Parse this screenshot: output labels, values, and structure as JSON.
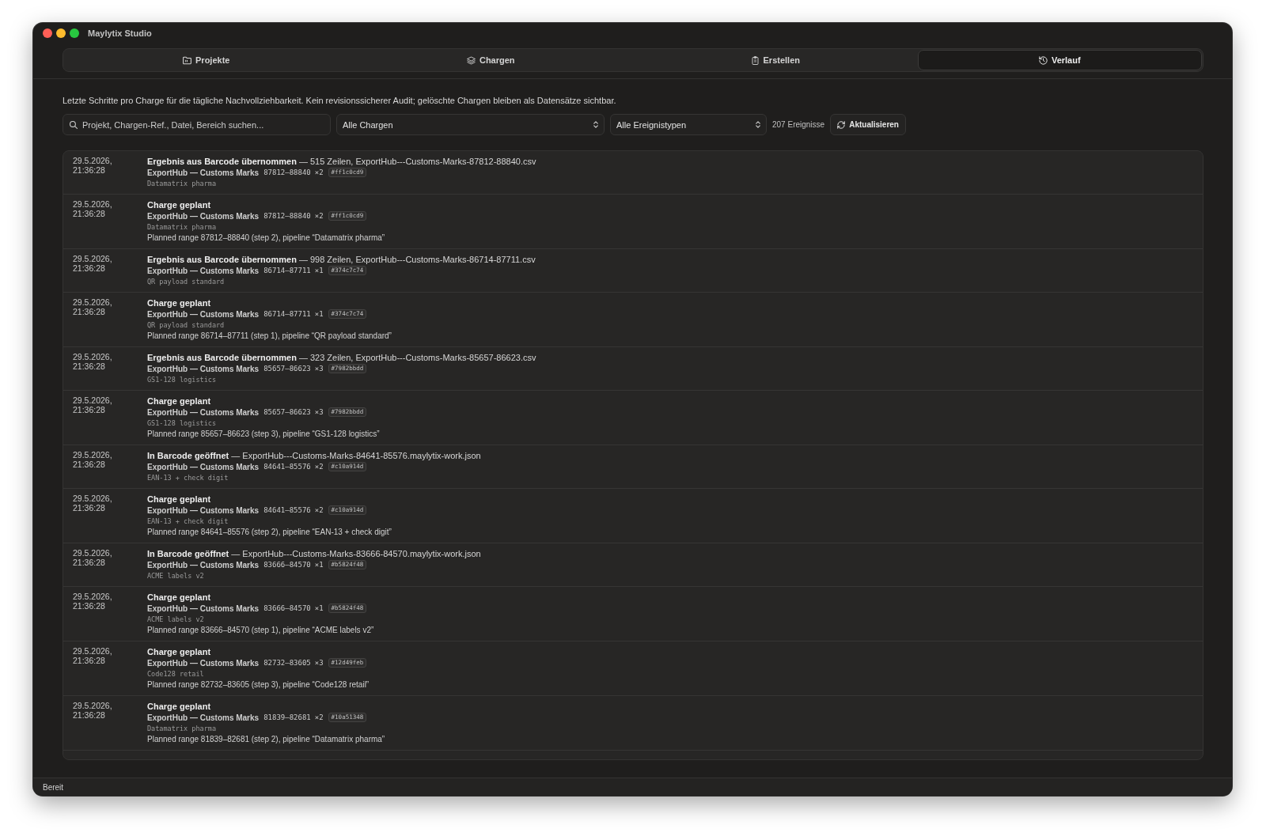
{
  "window": {
    "title": "Maylytix Studio"
  },
  "tabs": [
    {
      "label": "Projekte",
      "selected": false
    },
    {
      "label": "Chargen",
      "selected": false
    },
    {
      "label": "Erstellen",
      "selected": false
    },
    {
      "label": "Verlauf",
      "selected": true
    }
  ],
  "description": "Letzte Schritte pro Charge für die tägliche Nachvollziehbarkeit. Kein revisionssicherer Audit; gelöschte Chargen bleiben als Datensätze sichtbar.",
  "filters": {
    "search": {
      "placeholder": "Projekt, Chargen-Ref., Datei, Bereich suchen..."
    },
    "batch_select": {
      "value": "Alle Chargen"
    },
    "event_type_select": {
      "value": "Alle Ereignistypen"
    },
    "event_count": "207 Ereignisse",
    "refresh_button": "Aktualisieren"
  },
  "events": [
    {
      "timestamp": "29.5.2026, 21:36:28",
      "title": "Ergebnis aus Barcode übernommen",
      "detail": "— 515 Zeilen, ExportHub---Customs-Marks-87812-88840.csv",
      "project": "ExportHub — Customs Marks",
      "range": "87812–88840",
      "count": "×2",
      "hash": "#ff1c0cd9",
      "pipeline": "Datamatrix pharma"
    },
    {
      "timestamp": "29.5.2026, 21:36:28",
      "title": "Charge geplant",
      "project": "ExportHub — Customs Marks",
      "range": "87812–88840",
      "count": "×2",
      "hash": "#ff1c0cd9",
      "pipeline": "Datamatrix pharma",
      "note": "Planned range 87812–88840 (step 2), pipeline “Datamatrix pharma”"
    },
    {
      "timestamp": "29.5.2026, 21:36:28",
      "title": "Ergebnis aus Barcode übernommen",
      "detail": "— 998 Zeilen, ExportHub---Customs-Marks-86714-87711.csv",
      "project": "ExportHub — Customs Marks",
      "range": "86714–87711",
      "count": "×1",
      "hash": "#374c7c74",
      "pipeline": "QR payload standard"
    },
    {
      "timestamp": "29.5.2026, 21:36:28",
      "title": "Charge geplant",
      "project": "ExportHub — Customs Marks",
      "range": "86714–87711",
      "count": "×1",
      "hash": "#374c7c74",
      "pipeline": "QR payload standard",
      "note": "Planned range 86714–87711 (step 1), pipeline “QR payload standard”"
    },
    {
      "timestamp": "29.5.2026, 21:36:28",
      "title": "Ergebnis aus Barcode übernommen",
      "detail": "— 323 Zeilen, ExportHub---Customs-Marks-85657-86623.csv",
      "project": "ExportHub — Customs Marks",
      "range": "85657–86623",
      "count": "×3",
      "hash": "#7982bbdd",
      "pipeline": "GS1-128 logistics"
    },
    {
      "timestamp": "29.5.2026, 21:36:28",
      "title": "Charge geplant",
      "project": "ExportHub — Customs Marks",
      "range": "85657–86623",
      "count": "×3",
      "hash": "#7982bbdd",
      "pipeline": "GS1-128 logistics",
      "note": "Planned range 85657–86623 (step 3), pipeline “GS1-128 logistics”"
    },
    {
      "timestamp": "29.5.2026, 21:36:28",
      "title": "In Barcode geöffnet",
      "detail": "— ExportHub---Customs-Marks-84641-85576.maylytix-work.json",
      "project": "ExportHub — Customs Marks",
      "range": "84641–85576",
      "count": "×2",
      "hash": "#c10a914d",
      "pipeline": "EAN-13 + check digit"
    },
    {
      "timestamp": "29.5.2026, 21:36:28",
      "title": "Charge geplant",
      "project": "ExportHub — Customs Marks",
      "range": "84641–85576",
      "count": "×2",
      "hash": "#c10a914d",
      "pipeline": "EAN-13 + check digit",
      "note": "Planned range 84641–85576 (step 2), pipeline “EAN-13 + check digit”"
    },
    {
      "timestamp": "29.5.2026, 21:36:28",
      "title": "In Barcode geöffnet",
      "detail": "— ExportHub---Customs-Marks-83666-84570.maylytix-work.json",
      "project": "ExportHub — Customs Marks",
      "range": "83666–84570",
      "count": "×1",
      "hash": "#b5824f48",
      "pipeline": "ACME labels v2"
    },
    {
      "timestamp": "29.5.2026, 21:36:28",
      "title": "Charge geplant",
      "project": "ExportHub — Customs Marks",
      "range": "83666–84570",
      "count": "×1",
      "hash": "#b5824f48",
      "pipeline": "ACME labels v2",
      "note": "Planned range 83666–84570 (step 1), pipeline “ACME labels v2”"
    },
    {
      "timestamp": "29.5.2026, 21:36:28",
      "title": "Charge geplant",
      "project": "ExportHub — Customs Marks",
      "range": "82732–83605",
      "count": "×3",
      "hash": "#12d49feb",
      "pipeline": "Code128 retail",
      "note": "Planned range 82732–83605 (step 3), pipeline “Code128 retail”"
    },
    {
      "timestamp": "29.5.2026, 21:36:28",
      "title": "Charge geplant",
      "project": "ExportHub — Customs Marks",
      "range": "81839–82681",
      "count": "×2",
      "hash": "#10a51348",
      "pipeline": "Datamatrix pharma",
      "note": "Planned range 81839–82681 (step 2), pipeline “Datamatrix pharma”"
    }
  ],
  "status_bar": {
    "text": "Bereit"
  }
}
